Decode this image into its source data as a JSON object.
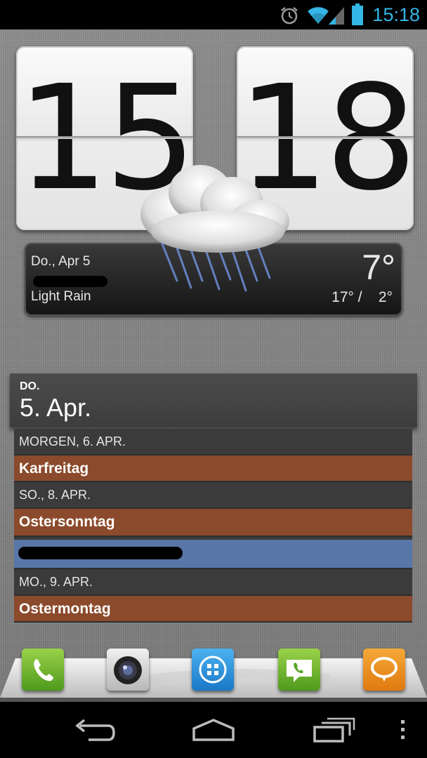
{
  "status_bar": {
    "time": "15:18",
    "icons": [
      "alarm-icon",
      "wifi-icon",
      "signal-icon",
      "battery-icon"
    ],
    "accent_color": "#33b5e5"
  },
  "clock": {
    "hours": "15",
    "minutes": "18"
  },
  "weather": {
    "date": "Do., Apr 5",
    "condition": "Light Rain",
    "temperature": "7°",
    "high": "17° /",
    "low": "2°",
    "icon": "rain-cloud-icon"
  },
  "calendar": {
    "day_of_week": "DO.",
    "date": "5. Apr.",
    "rows": [
      {
        "type": "date",
        "label": "MORGEN, 6. APR."
      },
      {
        "type": "event",
        "label": "Karfreitag",
        "color": "#8b4a2b"
      },
      {
        "type": "date",
        "label": "SO., 8. APR."
      },
      {
        "type": "event",
        "label": "Ostersonntag",
        "color": "#8b4a2b"
      },
      {
        "type": "event-redacted",
        "label": "",
        "color": "#5976a8"
      },
      {
        "type": "date",
        "label": "MO., 9. APR."
      },
      {
        "type": "event",
        "label": "Ostermontag",
        "color": "#8b4a2b"
      }
    ]
  },
  "dock": {
    "apps": [
      "phone-icon",
      "camera-icon",
      "app-drawer-icon",
      "messaging-icon",
      "talk-icon"
    ]
  },
  "navbar": {
    "buttons": [
      "back-icon",
      "home-icon",
      "recent-apps-icon",
      "menu-icon"
    ]
  }
}
